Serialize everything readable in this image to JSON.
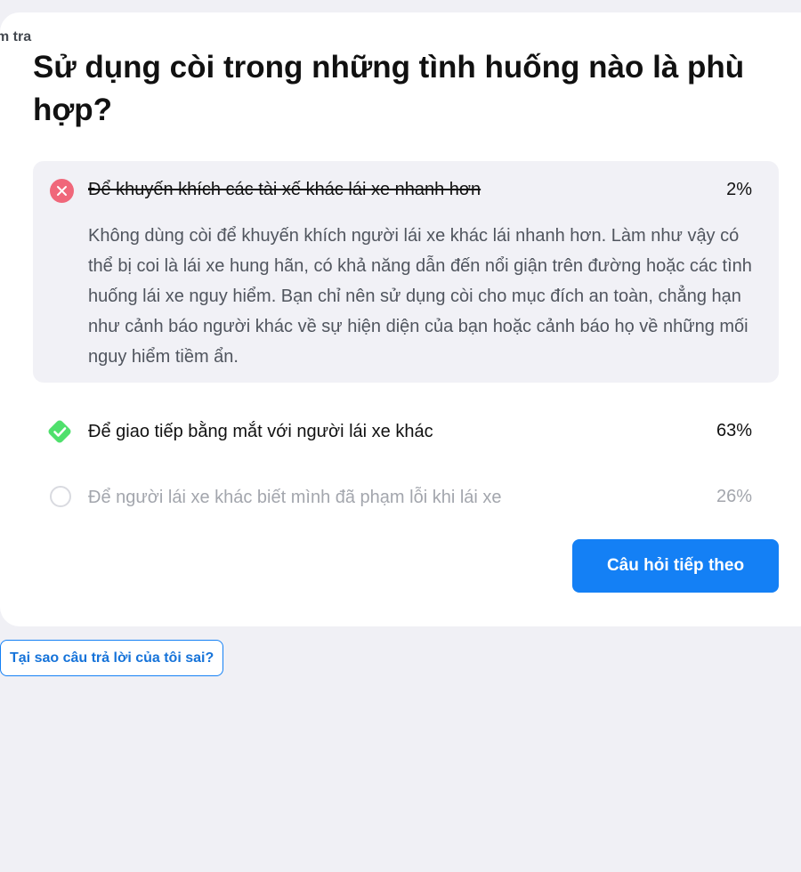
{
  "breadcrumb": "m tra",
  "question": "Sử dụng còi trong những tình huống nào là phù hợp?",
  "answers": [
    {
      "text": "Để khuyến khích các tài xế khác lái xe nhanh hơn",
      "percent": "2%",
      "state": "wrong",
      "explanation": "Không dùng còi để khuyến khích người lái xe khác lái nhanh hơn. Làm như vậy có thể bị coi là lái xe hung hãn, có khả năng dẫn đến nổi giận trên đường hoặc các tình huống lái xe nguy hiểm. Bạn chỉ nên sử dụng còi cho mục đích an toàn, chẳng hạn như cảnh báo người khác về sự hiện diện của bạn hoặc cảnh báo họ về những mối nguy hiểm tiềm ẩn."
    },
    {
      "text": "Để giao tiếp bằng mắt với người lái xe khác",
      "percent": "63%",
      "state": "correct"
    },
    {
      "text": "Để người lái xe khác biết mình đã phạm lỗi khi lái xe",
      "percent": "26%",
      "state": "unselected"
    }
  ],
  "next_button_label": "Câu hỏi tiếp theo",
  "why_wrong_label": "Tại sao câu trả lời của tôi sai?",
  "icons": {
    "wrong": "close-icon",
    "correct": "check-diamond-icon",
    "unselected": "empty-radio-icon"
  },
  "colors": {
    "background": "#f0f0f5",
    "card": "#ffffff",
    "wrong": "#f0677a",
    "correct": "#4fe06c",
    "accent": "#1480f5",
    "muted_text": "#a3a6ad"
  }
}
